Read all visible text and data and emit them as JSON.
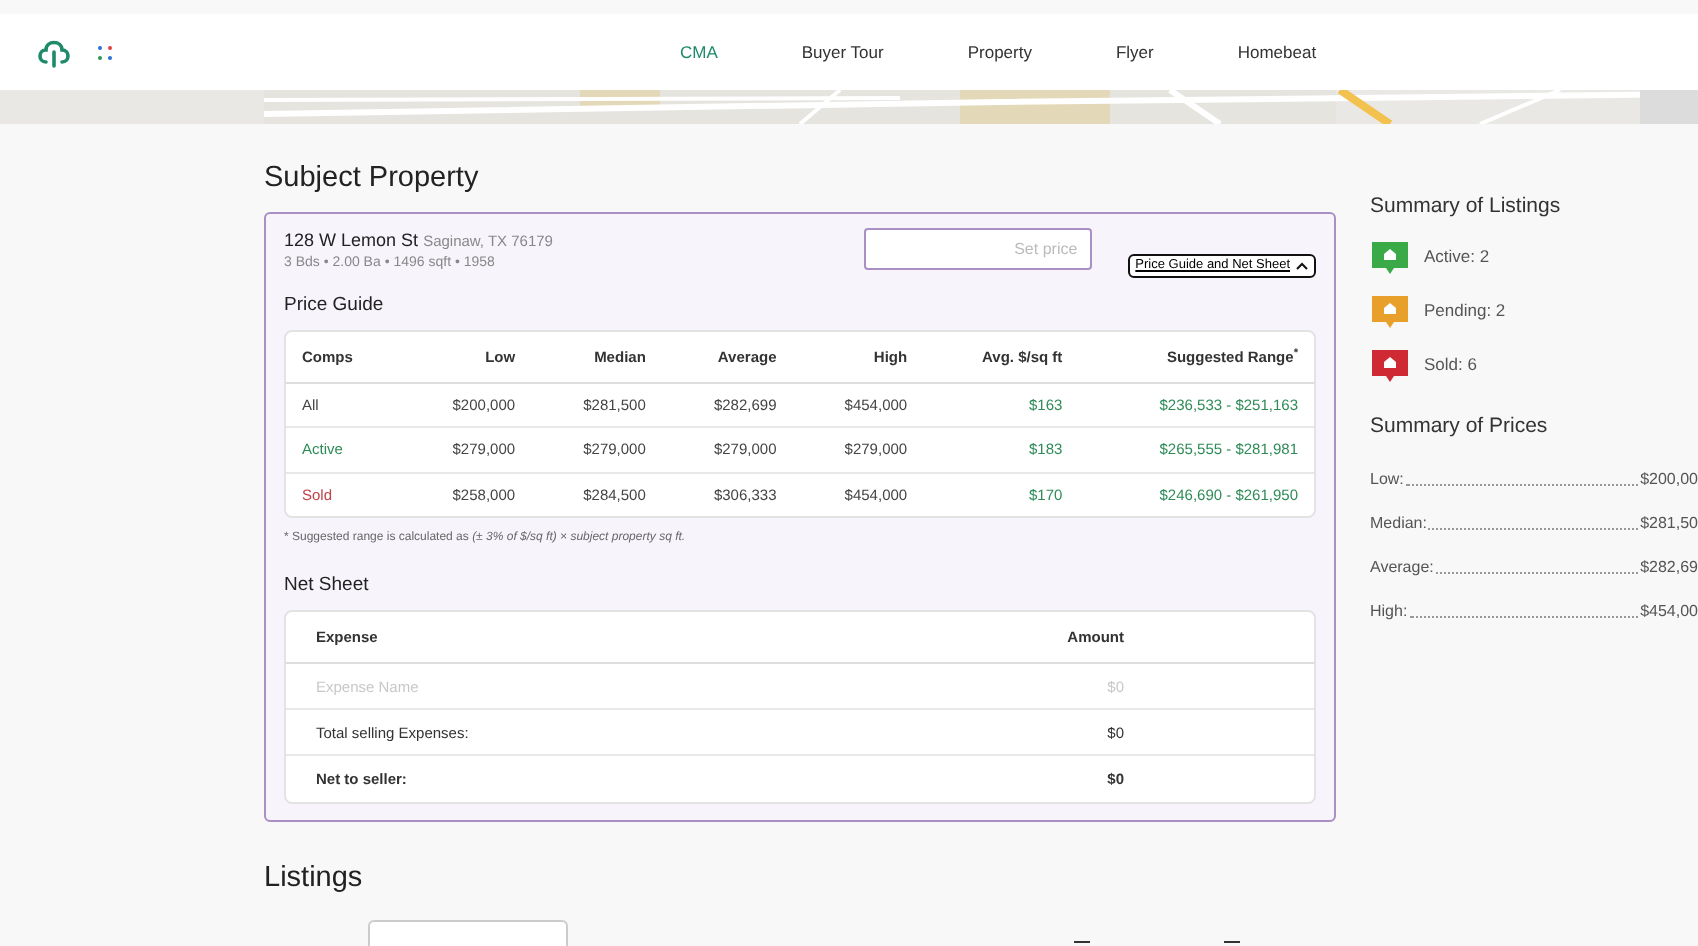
{
  "nav": {
    "tabs": [
      {
        "label": "CMA",
        "selected": true
      },
      {
        "label": "Buyer Tour",
        "selected": false
      },
      {
        "label": "Property",
        "selected": false
      },
      {
        "label": "Flyer",
        "selected": false
      },
      {
        "label": "Homebeat",
        "selected": false
      }
    ]
  },
  "subject": {
    "heading": "Subject Property",
    "address": "128 W Lemon St",
    "city": "Saginaw, TX 76179",
    "details": "3 Bds • 2.00 Ba • 1496 sqft • 1958",
    "price_placeholder": "Set price",
    "toggle": {
      "label": "Price Guide and Net Sheet",
      "expanded": true
    },
    "price_guide": {
      "title": "Price Guide",
      "columns": [
        "Comps",
        "Low",
        "Median",
        "Average",
        "High",
        "Avg. $/sq ft",
        "Suggested Range$^{*}$"
      ],
      "rows": [
        {
          "kind": "all",
          "cells": [
            "All",
            "$200,000",
            "$281,500",
            "$282,699",
            "$454,000",
            "$163",
            "$236,533 - $251,163"
          ]
        },
        {
          "kind": "active",
          "cells": [
            "Active",
            "$279,000",
            "$279,000",
            "$279,000",
            "$279,000",
            "$183",
            "$265,555 - $281,981"
          ]
        },
        {
          "kind": "sold",
          "cells": [
            "Sold",
            "$258,000",
            "$284,500",
            "$306,333",
            "$454,000",
            "$170",
            "$246,690 - $261,950"
          ]
        }
      ],
      "footnote": "* Suggested range is calculated as *(± 3% of $/sq ft) × subject property sq ft.*"
    },
    "net_sheet": {
      "title": "Net Sheet",
      "columns": [
        "Expense",
        "Amount"
      ],
      "rows": [
        {
          "kind": "input",
          "placeholder": "Expense Name",
          "amount_placeholder": "$0"
        },
        {
          "kind": "total",
          "cells": [
            "Total selling Expenses:",
            "$0"
          ]
        },
        {
          "kind": "net",
          "cells": [
            "Net to seller:",
            "$0"
          ]
        }
      ]
    }
  },
  "listings": {
    "heading": "Listings"
  },
  "summary_listings": {
    "title": "Summary of Listings",
    "items": [
      {
        "label": "Active: 2",
        "color": "#3aa948"
      },
      {
        "label": "Pending: 2",
        "color": "#e9a02a"
      },
      {
        "label": "Sold: 6",
        "color": "#cf2a33"
      }
    ]
  },
  "summary_prices": {
    "title": "Summary of Prices",
    "items": [
      {
        "label": "Low:",
        "value": "$200,00"
      },
      {
        "label": "Median:",
        "value": "$281,50"
      },
      {
        "label": "Average:",
        "value": "$282,69"
      },
      {
        "label": "High:",
        "value": "$454,00"
      }
    ]
  }
}
